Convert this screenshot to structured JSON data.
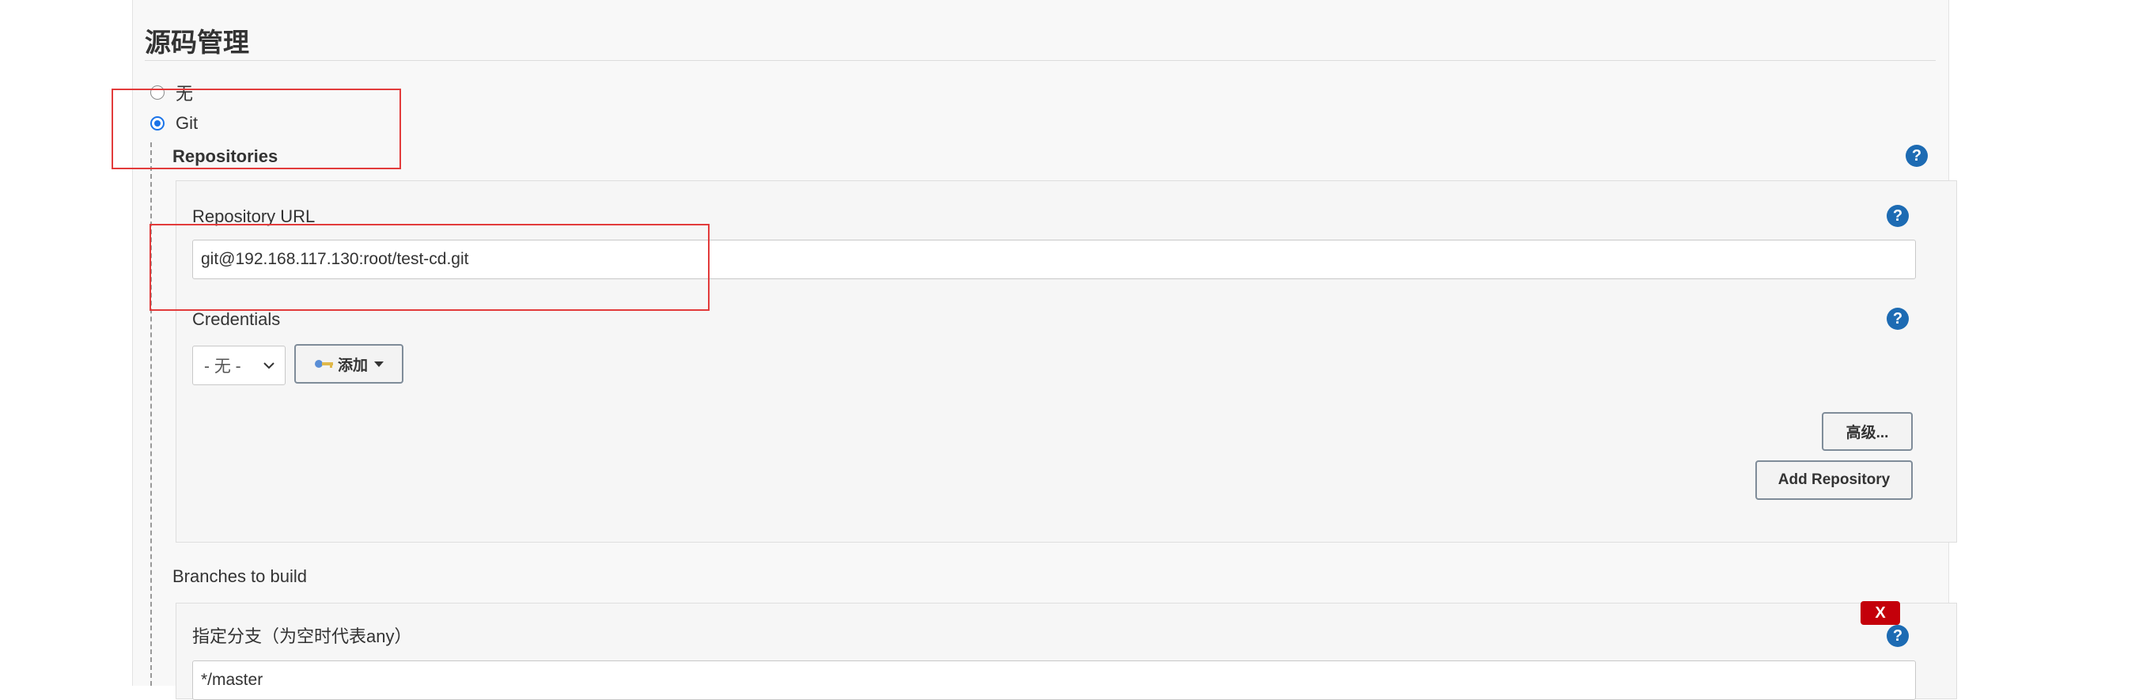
{
  "section": {
    "title": "源码管理"
  },
  "scm_options": {
    "none_label": "无",
    "git_label": "Git",
    "selected": "Git"
  },
  "repositories": {
    "label": "Repositories",
    "url_label": "Repository URL",
    "url_value": "git@192.168.117.130:root/test-cd.git",
    "credentials_label": "Credentials",
    "credentials_selected": "- 无 -",
    "add_label": "添加",
    "advanced_label": "高级...",
    "add_repository_label": "Add Repository"
  },
  "branches": {
    "label": "Branches to build",
    "branch_spec_label": "指定分支（为空时代表any）",
    "branch_spec_value": "*/master",
    "delete_label": "X"
  },
  "help_glyph": "?",
  "icons": {
    "help": "help-icon",
    "key": "key-icon",
    "chevron": "chevron-down-icon",
    "caret": "caret-down-icon"
  },
  "colors": {
    "radio_checked": "#1a73e8",
    "help_icon": "#1d6bb3",
    "delete_button": "#c4000a",
    "annotation_box": "#e23b3b"
  }
}
